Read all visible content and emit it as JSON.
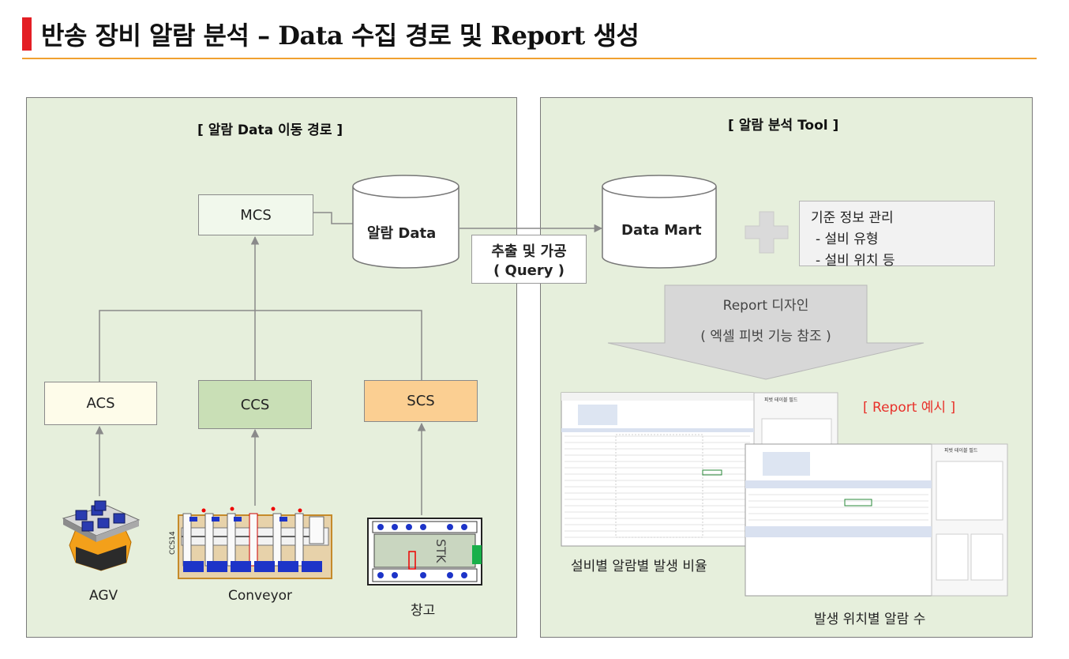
{
  "page": {
    "title": "반송 장비 알람 분석 – Data 수집 경로 및 Report 생성"
  },
  "left_panel": {
    "title": "[ 알람 Data 이동 경로 ]",
    "mcs_label": "MCS",
    "alarm_db_label": "알람 Data",
    "acs_label": "ACS",
    "ccs_label": "CCS",
    "scs_label": "SCS",
    "agv_label": "AGV",
    "conveyor_label": "Conveyor",
    "warehouse_label": "창고",
    "stk_label": "STK",
    "conveyor_tag": "CCS14"
  },
  "extract_box": {
    "line1": "추출 및 가공",
    "line2": "( Query )"
  },
  "right_panel": {
    "title": "[ 알람 분석 Tool ]",
    "datamart_label": "Data Mart",
    "ref_info": {
      "title": "기준 정보 관리",
      "item1": "- 설비 유형",
      "item2": "- 설비 위치 등"
    },
    "design_arrow": {
      "line1": "Report 디자인",
      "line2": "( 엑셀 피벗 기능 참조 )"
    },
    "report_example_label": "[ Report 예시 ]",
    "report1_caption": "설비별 알람별 발생 비율",
    "report2_caption": "발생 위치별 알람 수",
    "pivot_panel_title": "피벗 테이블 필드"
  },
  "colors": {
    "panel_bg": "#e6efdc",
    "mcs_fill": "#f1f8ec",
    "acs_fill": "#fefcea",
    "ccs_fill": "#c9dfb6",
    "scs_fill": "#fbcf92",
    "accent_red": "#e31e24",
    "title_rule": "#f0a030",
    "report_example_red": "#e8312a"
  }
}
